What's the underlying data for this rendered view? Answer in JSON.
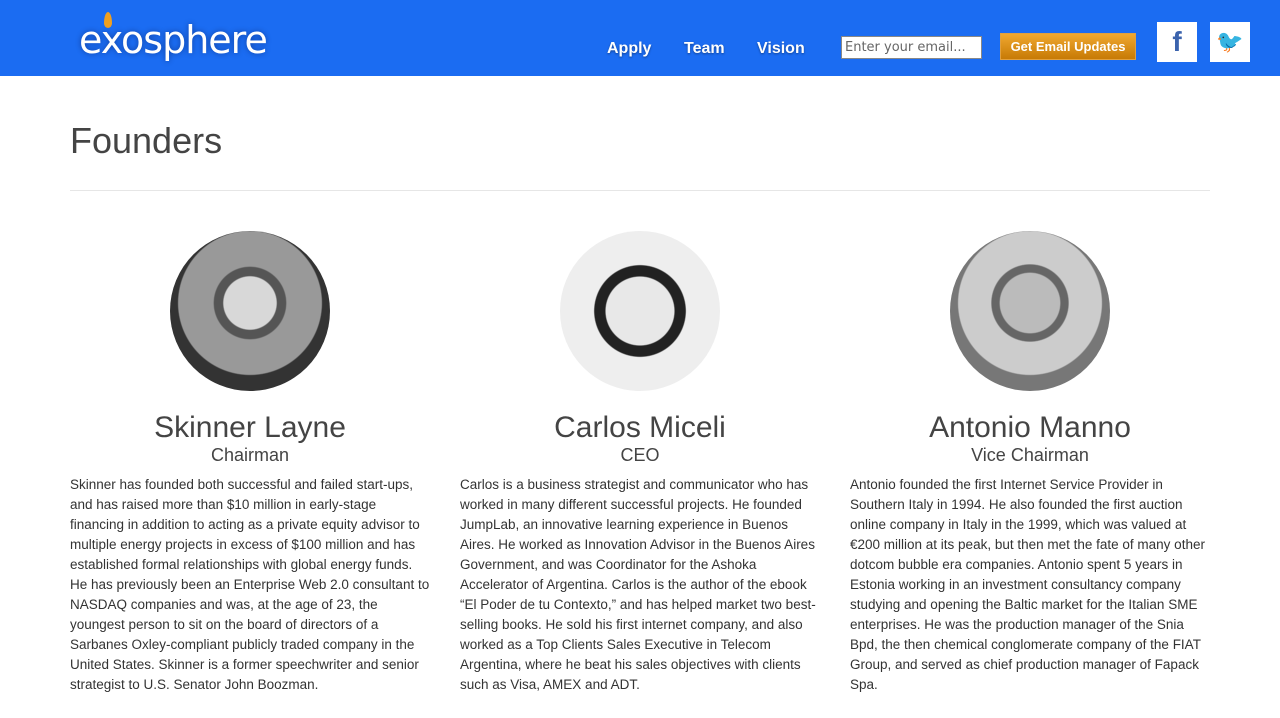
{
  "header": {
    "logo": "exosphere",
    "nav": [
      "Apply",
      "Team",
      "Vision"
    ],
    "email_placeholder": "Enter your email...",
    "email_button": "Get Email Updates",
    "social": [
      {
        "icon": "facebook-icon",
        "glyph": "f"
      },
      {
        "icon": "twitter-icon",
        "glyph": "🐦"
      }
    ],
    "brand_color": "#1b6cf2"
  },
  "page": {
    "title": "Founders"
  },
  "founders": [
    {
      "name": "Skinner Layne",
      "role": "Chairman",
      "bio": "Skinner has founded both successful and failed start-ups, and has raised more than $10 million in early-stage financing in addition to acting as a private equity advisor to multiple energy projects in excess of $100 million and has established formal relationships with global energy funds. He has previously been an Enterprise Web 2.0 consultant to NASDAQ companies and was, at the age of 23, the youngest person to sit on the board of directors of a Sarbanes Oxley-compliant publicly traded company in the United States. Skinner is a former speechwriter and senior strategist to U.S. Senator John Boozman."
    },
    {
      "name": "Carlos Miceli",
      "role": "CEO",
      "bio": "Carlos is a business strategist and communicator who has worked in many different successful projects. He founded JumpLab, an innovative learning experience in Buenos Aires. He worked as Innovation Advisor in the Buenos Aires Government, and was Coordinator for the Ashoka Accelerator of Argentina. Carlos is the author of the ebook “El Poder de tu Contexto,” and has helped market two best-selling books. He sold his first internet company, and also worked as a Top Clients Sales Executive in Telecom Argentina, where he beat his sales objectives with clients such as Visa, AMEX and ADT."
    },
    {
      "name": "Antonio Manno",
      "role": "Vice Chairman",
      "bio": "Antonio founded the first Internet Service Provider in Southern Italy in 1994. He also founded the first auction online company in Italy in the 1999, which was valued at €200 million at its peak, but then met the fate of many other dotcom bubble era companies. Antonio spent 5 years in Estonia working in an investment consultancy company studying and opening the Baltic market for the Italian SME enterprises. He was the production manager of the Snia Bpd, the then chemical conglomerate company of the FIAT Group, and served as chief production manager of Fapack Spa."
    }
  ]
}
